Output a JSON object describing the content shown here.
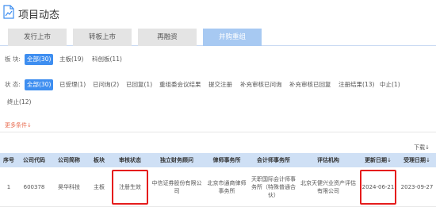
{
  "header": {
    "title": "项目动态",
    "icon": "document-icon"
  },
  "tabs": [
    {
      "label": "发行上市",
      "active": false
    },
    {
      "label": "转板上市",
      "active": false
    },
    {
      "label": "再融资",
      "active": false
    },
    {
      "label": "并购重组",
      "active": true
    }
  ],
  "board_filter": {
    "label": "板  块:",
    "options": [
      {
        "label": "全部(30)",
        "active": true
      },
      {
        "label": "主板(19)",
        "active": false
      },
      {
        "label": "科创板(11)",
        "active": false
      }
    ]
  },
  "status_filter": {
    "label": "状  态:",
    "options": [
      {
        "label": "全部(30)",
        "active": true
      },
      {
        "label": "已受理(1)",
        "active": false
      },
      {
        "label": "已问询(2)",
        "active": false
      },
      {
        "label": "已回复(1)",
        "active": false
      },
      {
        "label": "重组委会议结果",
        "active": false
      },
      {
        "label": "提交注册",
        "active": false
      },
      {
        "label": "补充审核已问询",
        "active": false
      },
      {
        "label": "补充审核已回复",
        "active": false
      },
      {
        "label": "注册结果(13)",
        "active": false
      },
      {
        "label": "中止(1)",
        "active": false
      },
      {
        "label": "终止(12)",
        "active": false
      }
    ]
  },
  "more_conditions": "更多条件↓",
  "download": "下载↓",
  "table": {
    "columns": [
      "序号",
      "公司代码",
      "公司简称",
      "板块",
      "审核状态",
      "独立财务顾问",
      "律师事务所",
      "会计师事务所",
      "评估机构",
      "更新日期",
      "受理日期"
    ],
    "sort_arrow": "↓",
    "rows": [
      {
        "index": "1",
        "code": "600378",
        "name": "昊华科技",
        "board": "主板",
        "status": "注册生效",
        "advisor": "中信证券股份有限公司",
        "law_firm": "北京市通商律师事务所",
        "accounting": "天职国际会计师事务所（特殊普通合伙）",
        "valuation": "北京天健兴业资产评估有限公司",
        "updated": "2024-06-21",
        "accepted": "2023-09-27"
      }
    ]
  },
  "colors": {
    "tab_active": "#a7c9f2",
    "chip_active": "#3e8ef0",
    "table_header": "#cfe0f5",
    "highlight": "#e51c1c",
    "more_link": "#e86a4e"
  }
}
